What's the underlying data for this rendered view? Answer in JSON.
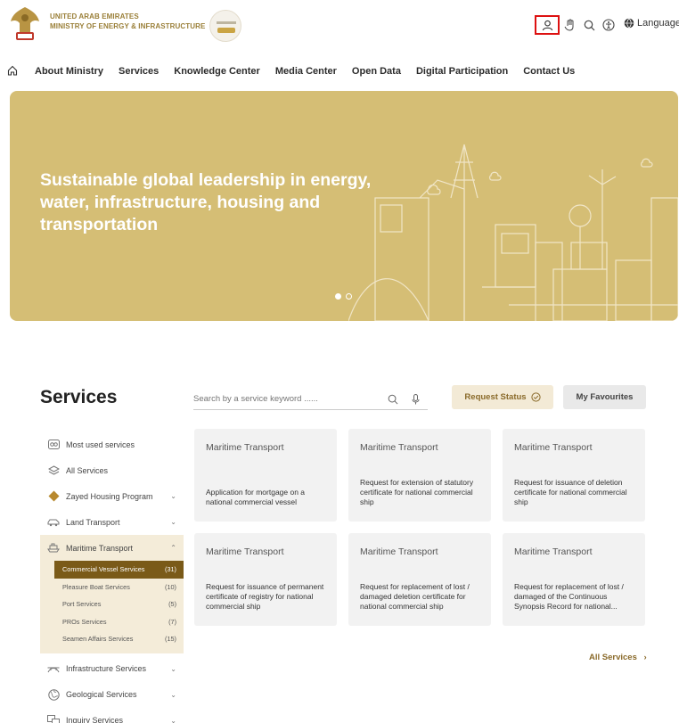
{
  "header": {
    "brand_line1": "UNITED ARAB EMIRATES",
    "brand_line2": "MINISTRY OF ENERGY & INFRASTRUCTURE",
    "languages_label": "Languages",
    "accent_color": "#d11111"
  },
  "nav": {
    "items": [
      "About Ministry",
      "Services",
      "Knowledge Center",
      "Media Center",
      "Open Data",
      "Digital Participation",
      "Contact Us"
    ]
  },
  "hero": {
    "title": "Sustainable global leadership in energy, water, infrastructure, housing and transportation",
    "background_color": "#d5be75",
    "slide_count": 2,
    "active_slide": 1
  },
  "services": {
    "title": "Services",
    "search_placeholder": "Search by a service keyword ......",
    "request_status_label": "Request Status",
    "favourites_label": "My Favourites",
    "all_services_label": "All Services",
    "sidebar": {
      "top_items": [
        {
          "label": "Most used services",
          "icon": "grid-icon"
        },
        {
          "label": "All Services",
          "icon": "layers-icon"
        },
        {
          "label": "Zayed Housing Program",
          "icon": "diamond-icon",
          "expandable": true
        },
        {
          "label": "Land Transport",
          "icon": "car-icon",
          "expandable": true
        }
      ],
      "open_item": {
        "label": "Maritime Transport",
        "icon": "ship-icon"
      },
      "sub_items": [
        {
          "label": "Commercial Vessel Services",
          "count": "(31)"
        },
        {
          "label": "Pleasure Boat Services",
          "count": "(10)"
        },
        {
          "label": "Port Services",
          "count": "(5)"
        },
        {
          "label": "PROs Services",
          "count": "(7)"
        },
        {
          "label": "Seamen Affairs Services",
          "count": "(15)"
        }
      ],
      "bottom_items": [
        {
          "label": "Infrastructure Services",
          "icon": "bridge-icon"
        },
        {
          "label": "Geological Services",
          "icon": "globe-icon"
        },
        {
          "label": "Inquiry Services",
          "icon": "inquiry-icon"
        }
      ]
    },
    "cards": [
      {
        "category": "Maritime Transport",
        "description": "Application for mortgage on a national commercial vessel"
      },
      {
        "category": "Maritime Transport",
        "description": "Request for extension of statutory certificate for national commercial ship"
      },
      {
        "category": "Maritime Transport",
        "description": "Request for issuance of deletion certificate for national commercial ship"
      },
      {
        "category": "Maritime Transport",
        "description": "Request for issuance of permanent certificate of registry for national commercial ship"
      },
      {
        "category": "Maritime Transport",
        "description": "Request for replacement of lost / damaged deletion certificate for national commercial ship"
      },
      {
        "category": "Maritime Transport",
        "description": "Request for replacement of lost / damaged of the Continuous Synopsis Record for national..."
      }
    ]
  }
}
